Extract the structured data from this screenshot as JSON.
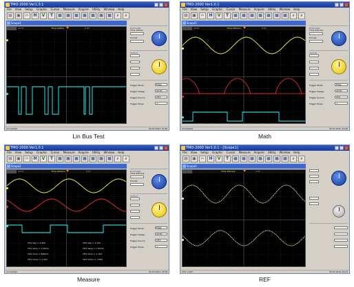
{
  "colors": {
    "ch1": "#ffff40",
    "ch2": "#ff3030",
    "ch3": "#30ffff",
    "ref": "#ffffc0",
    "grid": "#4a4a4a",
    "window_title": "#1c48b4",
    "trigger_marker": "#ff8c1a"
  },
  "shots": [
    {
      "caption": "Lin Bus Test",
      "window_title": "TMO-2000 Ver1.0.1",
      "document": "Scope1",
      "menu": [
        "File",
        "View",
        "Setup",
        "Graphic",
        "Cursor",
        "Measure",
        "Acquire",
        "Utility",
        "Window",
        "Help"
      ],
      "toolbar": [
        "H",
        "V",
        "T",
        "#",
        "#",
        "#",
        "#",
        "#",
        "#",
        "#",
        "#",
        "#",
        "⌕",
        "⌕"
      ],
      "info": {
        "mode": "AUTO",
        "timebase": "Time 100ms",
        "stat": "0.0V"
      },
      "panel": {
        "horizontal": "Horizontal",
        "h_time": "Time 100ms",
        "format": "Format",
        "vertical": "Vertical",
        "trigger_mode_label": "Trigger Mode",
        "trigger_mode": "Edge",
        "trigger_sweep_label": "Trigger Sweep",
        "trigger_sweep": "AUTO",
        "trigger_source_label": "Trigger Source",
        "trigger_source": "CH1",
        "trigger_slope_label": "Trigger Slope",
        "trigger_slope": "+"
      },
      "status": {
        "left": "Connected",
        "right": "05-07-2011  13:46"
      }
    },
    {
      "caption": "Math",
      "window_title": "TMO-2000 Ver1.0.1",
      "document": "Scope1",
      "menu": [
        "File",
        "View",
        "Setup",
        "Graphic",
        "Cursor",
        "Measure",
        "Acquire",
        "Utility",
        "Window",
        "Help"
      ],
      "toolbar": [
        "H",
        "V",
        "T",
        "#",
        "#",
        "#",
        "#",
        "#",
        "#",
        "#",
        "#",
        "#",
        "⌕",
        "⌕"
      ],
      "info": {
        "mode": "AUTO",
        "timebase": "Time 200.0us",
        "stat": "0.0V"
      },
      "panel": {
        "horizontal": "Horizontal",
        "h_time": "Time 200.0us",
        "format": "Format",
        "vertical": "Vertical",
        "trigger_mode_label": "Trigger Mode",
        "trigger_mode": "Edge",
        "trigger_sweep_label": "Trigger Sweep",
        "trigger_sweep": "AUTO",
        "trigger_source_label": "Trigger Source",
        "trigger_source": "CH1",
        "trigger_slope_label": "Trigger Slope",
        "trigger_slope": "+"
      },
      "status": {
        "left": "Connected",
        "right": "05-07-2011  14:46"
      }
    },
    {
      "caption": "Measure",
      "window_title": "TMO-2000 Ver1.0.1",
      "document": "Scope1",
      "menu": [
        "File",
        "View",
        "Setup",
        "Graphic",
        "Cursor",
        "Measure",
        "Acquire",
        "Utility",
        "Window",
        "Help"
      ],
      "toolbar": [
        "H",
        "V",
        "T",
        "#",
        "#",
        "#",
        "#",
        "#",
        "#",
        "#",
        "#",
        "#",
        "⌕",
        "⌕"
      ],
      "info": {
        "mode": "AUTO",
        "timebase": "Time 200.0us",
        "stat": "0.0V"
      },
      "panel": {
        "horizontal": "Horizontal",
        "h_time": "Time 200.0us",
        "format": "Format",
        "vertical": "Vertical",
        "trigger_mode_label": "Trigger Mode",
        "trigger_mode": "Edge",
        "trigger_sweep_label": "Trigger Sweep",
        "trigger_sweep": "AUTO",
        "trigger_source_label": "Trigger Source",
        "trigger_source": "CH1",
        "trigger_slope_label": "Trigger Slope",
        "trigger_slope": "+"
      },
      "measurements": [
        "CH1 Vpp = 2.40V",
        "CH2 Vpp = 3.12V",
        "CH1 Vavg = 1.20mV",
        "CH2 Vavg = 1.52mV",
        "CH1 Vrms = 849mV",
        "CH2 Vrms = 1.10V",
        "CH1 Vmax = 1.20V",
        "CH2 Vmax = 1.56V"
      ],
      "status": {
        "left": "Connected",
        "right": "05-07-2011  13:56"
      }
    },
    {
      "caption": "REF",
      "window_title": "TMO-2000 Ver1.0.1 - [Scope1]",
      "document": "Scope1",
      "menu": [
        "File",
        "View",
        "Setup",
        "Graphic",
        "Cursor",
        "Measure",
        "Acquire",
        "Utility",
        "Window",
        "Help"
      ],
      "toolbar": [
        "H",
        "V",
        "T",
        "#",
        "#",
        "#",
        "#",
        "#",
        "#",
        "#",
        "#",
        "#",
        "⌕",
        "⌕"
      ],
      "info": {
        "mode": "",
        "timebase": "Time 200.0us",
        "stat": "0.0V"
      },
      "panel": {
        "horizontal": "",
        "h_time": "",
        "format": "",
        "vertical": "",
        "trigger_mode_label": "",
        "trigger_mode": "",
        "trigger_sweep_label": "",
        "trigger_sweep": "",
        "trigger_source_label": "",
        "trigger_source": "",
        "trigger_slope_label": "",
        "trigger_slope": ""
      },
      "status": {
        "left": "CH1  1.00V",
        "right": "05-07-2011  14:23"
      }
    }
  ]
}
